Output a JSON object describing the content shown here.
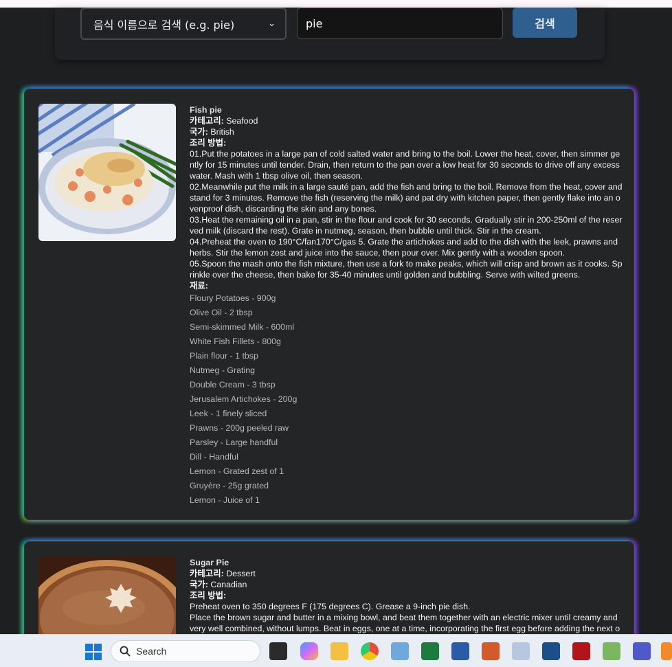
{
  "search": {
    "select_value": "음식 이름으로 검색 (e.g. pie)",
    "input_value": "pie",
    "button_label": "검색"
  },
  "labels": {
    "category": "카테고리:",
    "country": "국가:",
    "method": "조리 방법:",
    "ingredients": "재료:"
  },
  "recipes": [
    {
      "title": "Fish pie",
      "category": "Seafood",
      "country": "British",
      "method": [
        "01.Put the potatoes in a large pan of cold salted water and bring to the boil. Lower the heat, cover, then simmer gently for 15 minutes until tender. Drain, then return to the pan over a low heat for 30 seconds to drive off any excess water. Mash with 1 tbsp olive oil, then season.",
        "02.Meanwhile put the milk in a large sauté pan, add the fish and bring to the boil. Remove from the heat, cover and stand for 3 minutes. Remove the fish (reserving the milk) and pat dry with kitchen paper, then gently flake into an ovenproof dish, discarding the skin and any bones.",
        "03.Heat the remaining oil in a pan, stir in the flour and cook for 30 seconds. Gradually stir in 200-250ml of the reserved milk (discard the rest). Grate in nutmeg, season, then bubble until thick. Stir in the cream.",
        "04.Preheat the oven to 190°C/fan170°C/gas 5. Grate the artichokes and add to the dish with the leek, prawns and herbs. Stir the lemon zest and juice into the sauce, then pour over. Mix gently with a wooden spoon.",
        "05.Spoon the mash onto the fish mixture, then use a fork to make peaks, which will crisp and brown as it cooks. Sprinkle over the cheese, then bake for 35-40 minutes until golden and bubbling. Serve with wilted greens."
      ],
      "ingredients": [
        "Floury Potatoes - 900g",
        "Olive Oil - 2 tbsp",
        "Semi-skimmed Milk - 600ml",
        "White Fish Fillets - 800g",
        "Plain flour - 1 tbsp",
        "Nutmeg - Grating",
        "Double Cream - 3 tbsp",
        "Jerusalem Artichokes - 200g",
        "Leek - 1 finely sliced",
        "Prawns - 200g peeled raw",
        "Parsley - Large handful",
        "Dill - Handful",
        "Lemon - Grated zest of 1",
        "Gruyère - 25g grated",
        "Lemon - Juice of 1"
      ]
    },
    {
      "title": "Sugar Pie",
      "category": "Dessert",
      "country": "Canadian",
      "method": [
        "Preheat oven to 350 degrees F (175 degrees C). Grease a 9-inch pie dish.",
        "Place the brown sugar and butter in a mixing bowl, and beat them together with an electric mixer until creamy and very well combined, without lumps. Beat in eggs, one at a time, incorporating the first egg before adding the next one."
      ]
    }
  ],
  "taskbar": {
    "search_placeholder": "Search",
    "icons": [
      "windows-start-icon",
      "search-icon",
      "task-view-icon",
      "copilot-icon",
      "file-explorer-icon",
      "chrome-icon",
      "remote-desktop-icon",
      "excel-icon",
      "word-icon",
      "powerpoint-icon",
      "document-icon",
      "notepad-icon",
      "filezilla-icon",
      "notepad-plus-plus-icon",
      "teams-icon",
      "app-icon"
    ]
  },
  "colors": {
    "background": "#1e1f21",
    "card": "#242527",
    "button": "#2f5f8f",
    "taskbar": "#e9eef5"
  }
}
